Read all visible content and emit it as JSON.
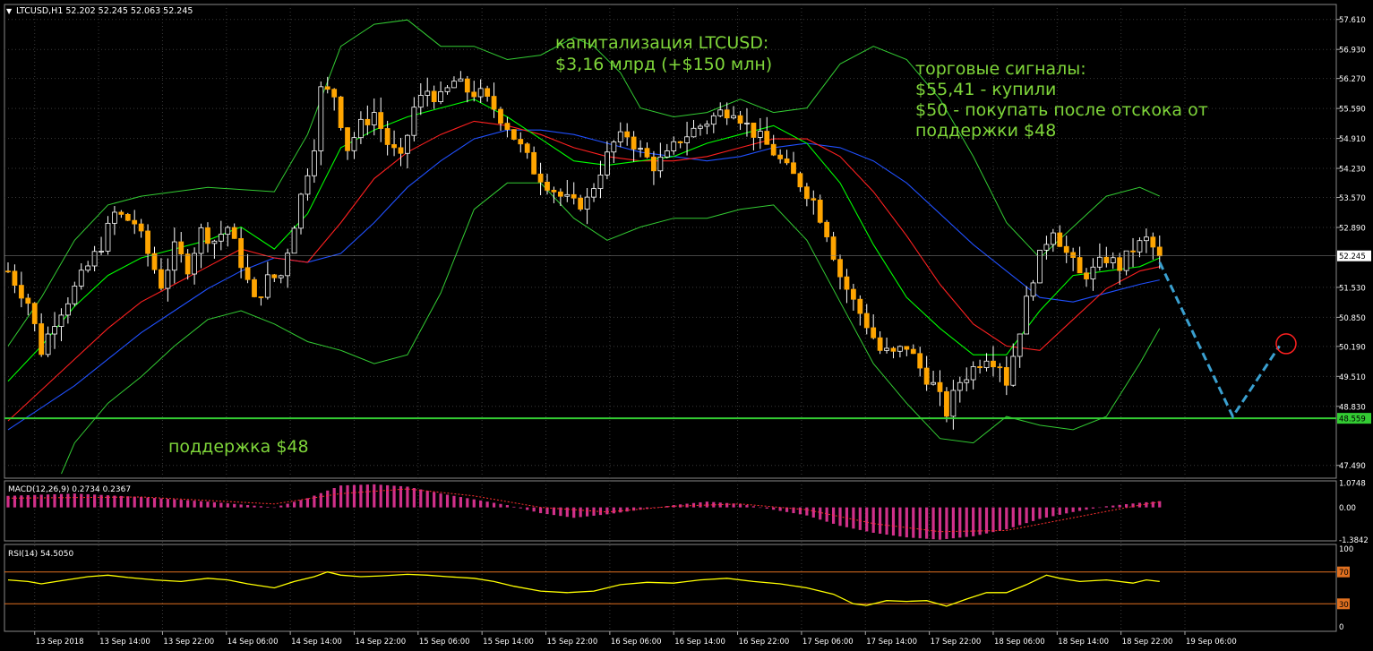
{
  "header": {
    "symbol_info": "LTCUSD,H1  52.202 52.245 52.063 52.245",
    "menu_arrow_icon": "triangle-down-icon"
  },
  "annotations": {
    "cap_line1": "капитализация LTCUSD:",
    "cap_line2": "$3,16 млрд (+$150 млн)",
    "signals_line1": "торговые сигналы:",
    "signals_line2": "$55,41 - купили",
    "signals_line3": "$50 - покупать после отскока от",
    "signals_line4": "поддержки $48",
    "support_label": "поддержка $48"
  },
  "colors": {
    "background": "#000000",
    "grid": "#3a3a3a",
    "bull_candle": "#000000",
    "bear_candle": "#ffa500",
    "bollinger": "#33cc33",
    "ma_fast": "#00ff00",
    "ma_mid": "#ff2020",
    "ma_slow": "#2050ff",
    "support": "#33cc33",
    "annotation_text": "#7fd63a",
    "forecast": "#3aa0d0",
    "target_circle": "#ff2020",
    "macd_hist": "#d0308a",
    "macd_signal": "#ff3030",
    "rsi_line": "#ffff00",
    "rsi_levels": "#e07020",
    "axis_text": "#ffffff"
  },
  "chart_data": {
    "type": "candlestick",
    "symbol": "LTCUSD",
    "timeframe": "H1",
    "ohlc_header": {
      "open": 52.202,
      "high": 52.245,
      "low": 52.063,
      "close": 52.245
    },
    "price_axis_ticks": [
      "57.610",
      "56.930",
      "56.270",
      "55.590",
      "54.910",
      "54.230",
      "53.570",
      "52.890",
      "52.245",
      "51.530",
      "50.850",
      "50.190",
      "49.510",
      "48.830",
      "48.559",
      "47.490"
    ],
    "ylim": [
      47.2,
      57.95
    ],
    "current_price": 52.245,
    "current_price_label": "52.245",
    "support_level": 48.559,
    "support_price_label": "48.559",
    "time_labels": [
      "13 Sep 2018",
      "13 Sep 14:00",
      "13 Sep 22:00",
      "14 Sep 06:00",
      "14 Sep 14:00",
      "14 Sep 22:00",
      "15 Sep 06:00",
      "15 Sep 14:00",
      "15 Sep 22:00",
      "16 Sep 06:00",
      "16 Sep 14:00",
      "16 Sep 22:00",
      "17 Sep 06:00",
      "17 Sep 14:00",
      "17 Sep 22:00",
      "18 Sep 06:00",
      "18 Sep 14:00",
      "18 Sep 22:00",
      "19 Sep 06:00"
    ],
    "close_path": [
      [
        0,
        51.9
      ],
      [
        3,
        51.2
      ],
      [
        5,
        50.1
      ],
      [
        7,
        50.8
      ],
      [
        10,
        51.5
      ],
      [
        14,
        52.5
      ],
      [
        16,
        53.2
      ],
      [
        19,
        53.0
      ],
      [
        21,
        52.3
      ],
      [
        23,
        51.6
      ],
      [
        25,
        52.4
      ],
      [
        27,
        52.0
      ],
      [
        29,
        52.8
      ],
      [
        31,
        52.6
      ],
      [
        33,
        52.9
      ],
      [
        35,
        52.1
      ],
      [
        37,
        51.2
      ],
      [
        39,
        51.7
      ],
      [
        41,
        51.8
      ],
      [
        42,
        52.4
      ],
      [
        44,
        53.6
      ],
      [
        46,
        54.8
      ],
      [
        47,
        56.0
      ],
      [
        49,
        55.9
      ],
      [
        51,
        54.7
      ],
      [
        53,
        55.2
      ],
      [
        55,
        55.5
      ],
      [
        57,
        54.8
      ],
      [
        59,
        54.4
      ],
      [
        61,
        55.6
      ],
      [
        63,
        56.0
      ],
      [
        65,
        55.8
      ],
      [
        67,
        56.2
      ],
      [
        69,
        56.0
      ],
      [
        71,
        55.9
      ],
      [
        73,
        55.6
      ],
      [
        75,
        55.2
      ],
      [
        77,
        54.7
      ],
      [
        79,
        54.2
      ],
      [
        81,
        53.9
      ],
      [
        83,
        53.6
      ],
      [
        85,
        53.4
      ],
      [
        87,
        53.5
      ],
      [
        89,
        54.2
      ],
      [
        91,
        54.8
      ],
      [
        93,
        55.0
      ],
      [
        95,
        54.6
      ],
      [
        97,
        54.3
      ],
      [
        99,
        54.5
      ],
      [
        101,
        54.9
      ],
      [
        103,
        55.1
      ],
      [
        105,
        55.3
      ],
      [
        107,
        55.5
      ],
      [
        109,
        55.6
      ],
      [
        111,
        55.2
      ],
      [
        113,
        54.9
      ],
      [
        115,
        54.6
      ],
      [
        117,
        54.2
      ],
      [
        119,
        53.9
      ],
      [
        121,
        53.5
      ],
      [
        123,
        52.8
      ],
      [
        125,
        51.8
      ],
      [
        127,
        51.2
      ],
      [
        129,
        50.7
      ],
      [
        131,
        50.1
      ],
      [
        133,
        50.0
      ],
      [
        135,
        50.2
      ],
      [
        137,
        49.7
      ],
      [
        139,
        49.3
      ],
      [
        141,
        48.7
      ],
      [
        143,
        49.4
      ],
      [
        145,
        49.7
      ],
      [
        147,
        50.0
      ],
      [
        149,
        49.8
      ],
      [
        150,
        49.4
      ],
      [
        152,
        50.6
      ],
      [
        154,
        51.8
      ],
      [
        156,
        52.6
      ],
      [
        157,
        52.9
      ],
      [
        159,
        52.3
      ],
      [
        161,
        51.8
      ],
      [
        163,
        51.9
      ],
      [
        165,
        52.2
      ],
      [
        167,
        52.0
      ],
      [
        169,
        52.4
      ],
      [
        171,
        52.6
      ],
      [
        173,
        52.245
      ]
    ],
    "bb_upper": [
      [
        0,
        50.2
      ],
      [
        5,
        51.3
      ],
      [
        10,
        52.6
      ],
      [
        15,
        53.4
      ],
      [
        20,
        53.6
      ],
      [
        30,
        53.8
      ],
      [
        40,
        53.7
      ],
      [
        45,
        55.0
      ],
      [
        50,
        57.0
      ],
      [
        55,
        57.5
      ],
      [
        60,
        57.6
      ],
      [
        65,
        57.0
      ],
      [
        70,
        57.0
      ],
      [
        75,
        56.7
      ],
      [
        80,
        56.8
      ],
      [
        85,
        57.2
      ],
      [
        88,
        57.0
      ],
      [
        92,
        56.4
      ],
      [
        95,
        55.6
      ],
      [
        100,
        55.4
      ],
      [
        105,
        55.5
      ],
      [
        110,
        55.8
      ],
      [
        115,
        55.5
      ],
      [
        120,
        55.6
      ],
      [
        125,
        56.6
      ],
      [
        130,
        57.0
      ],
      [
        135,
        56.7
      ],
      [
        140,
        55.8
      ],
      [
        145,
        54.5
      ],
      [
        150,
        53.0
      ],
      [
        155,
        52.2
      ],
      [
        160,
        52.9
      ],
      [
        165,
        53.6
      ],
      [
        170,
        53.8
      ],
      [
        173,
        53.6
      ]
    ],
    "bb_lower": [
      [
        8,
        47.3
      ],
      [
        10,
        48.0
      ],
      [
        15,
        48.9
      ],
      [
        20,
        49.5
      ],
      [
        25,
        50.2
      ],
      [
        30,
        50.8
      ],
      [
        35,
        51.0
      ],
      [
        40,
        50.7
      ],
      [
        45,
        50.3
      ],
      [
        50,
        50.1
      ],
      [
        55,
        49.8
      ],
      [
        60,
        50.0
      ],
      [
        65,
        51.4
      ],
      [
        70,
        53.3
      ],
      [
        75,
        53.9
      ],
      [
        80,
        53.9
      ],
      [
        85,
        53.1
      ],
      [
        90,
        52.6
      ],
      [
        95,
        52.9
      ],
      [
        100,
        53.1
      ],
      [
        105,
        53.1
      ],
      [
        110,
        53.3
      ],
      [
        115,
        53.4
      ],
      [
        120,
        52.6
      ],
      [
        125,
        51.2
      ],
      [
        130,
        49.8
      ],
      [
        135,
        48.9
      ],
      [
        140,
        48.1
      ],
      [
        145,
        48.0
      ],
      [
        150,
        48.6
      ],
      [
        155,
        48.4
      ],
      [
        160,
        48.3
      ],
      [
        165,
        48.6
      ],
      [
        170,
        49.8
      ],
      [
        173,
        50.6
      ]
    ],
    "ma_fast": [
      [
        0,
        49.4
      ],
      [
        5,
        50.2
      ],
      [
        10,
        51.1
      ],
      [
        15,
        51.8
      ],
      [
        20,
        52.2
      ],
      [
        25,
        52.4
      ],
      [
        30,
        52.6
      ],
      [
        35,
        52.9
      ],
      [
        40,
        52.4
      ],
      [
        45,
        53.2
      ],
      [
        50,
        54.7
      ],
      [
        55,
        55.1
      ],
      [
        60,
        55.4
      ],
      [
        65,
        55.6
      ],
      [
        70,
        55.8
      ],
      [
        75,
        55.4
      ],
      [
        80,
        54.9
      ],
      [
        85,
        54.4
      ],
      [
        90,
        54.3
      ],
      [
        95,
        54.4
      ],
      [
        100,
        54.5
      ],
      [
        105,
        54.8
      ],
      [
        110,
        55.0
      ],
      [
        115,
        55.2
      ],
      [
        120,
        54.8
      ],
      [
        125,
        53.9
      ],
      [
        130,
        52.5
      ],
      [
        135,
        51.3
      ],
      [
        140,
        50.6
      ],
      [
        145,
        50.0
      ],
      [
        150,
        50.0
      ],
      [
        155,
        51.0
      ],
      [
        160,
        51.8
      ],
      [
        165,
        51.9
      ],
      [
        170,
        52.0
      ],
      [
        173,
        52.2
      ]
    ],
    "ma_mid": [
      [
        0,
        48.5
      ],
      [
        5,
        49.2
      ],
      [
        10,
        49.9
      ],
      [
        15,
        50.6
      ],
      [
        20,
        51.2
      ],
      [
        25,
        51.6
      ],
      [
        30,
        52.0
      ],
      [
        35,
        52.4
      ],
      [
        40,
        52.2
      ],
      [
        45,
        52.1
      ],
      [
        50,
        53.0
      ],
      [
        55,
        54.0
      ],
      [
        60,
        54.6
      ],
      [
        65,
        55.0
      ],
      [
        70,
        55.3
      ],
      [
        75,
        55.2
      ],
      [
        80,
        55.0
      ],
      [
        85,
        54.7
      ],
      [
        90,
        54.5
      ],
      [
        95,
        54.4
      ],
      [
        100,
        54.4
      ],
      [
        105,
        54.5
      ],
      [
        110,
        54.7
      ],
      [
        115,
        54.9
      ],
      [
        120,
        54.9
      ],
      [
        125,
        54.5
      ],
      [
        130,
        53.7
      ],
      [
        135,
        52.7
      ],
      [
        140,
        51.6
      ],
      [
        145,
        50.7
      ],
      [
        150,
        50.2
      ],
      [
        155,
        50.1
      ],
      [
        160,
        50.8
      ],
      [
        165,
        51.5
      ],
      [
        170,
        51.9
      ],
      [
        173,
        52.0
      ]
    ],
    "ma_slow": [
      [
        0,
        48.3
      ],
      [
        5,
        48.8
      ],
      [
        10,
        49.3
      ],
      [
        15,
        49.9
      ],
      [
        20,
        50.5
      ],
      [
        25,
        51.0
      ],
      [
        30,
        51.5
      ],
      [
        35,
        51.9
      ],
      [
        40,
        52.2
      ],
      [
        45,
        52.1
      ],
      [
        50,
        52.3
      ],
      [
        55,
        53.0
      ],
      [
        60,
        53.8
      ],
      [
        65,
        54.4
      ],
      [
        70,
        54.9
      ],
      [
        75,
        55.1
      ],
      [
        80,
        55.1
      ],
      [
        85,
        55.0
      ],
      [
        90,
        54.8
      ],
      [
        95,
        54.6
      ],
      [
        100,
        54.5
      ],
      [
        105,
        54.4
      ],
      [
        110,
        54.5
      ],
      [
        115,
        54.7
      ],
      [
        120,
        54.8
      ],
      [
        125,
        54.7
      ],
      [
        130,
        54.4
      ],
      [
        135,
        53.9
      ],
      [
        140,
        53.2
      ],
      [
        145,
        52.5
      ],
      [
        150,
        51.9
      ],
      [
        155,
        51.3
      ],
      [
        160,
        51.2
      ],
      [
        165,
        51.4
      ],
      [
        170,
        51.6
      ],
      [
        173,
        51.7
      ]
    ],
    "forecast_path": [
      [
        173,
        52.1
      ],
      [
        184,
        48.6
      ],
      [
        191,
        50.2
      ]
    ],
    "target_point": [
      192,
      50.25
    ],
    "macd": {
      "label": "MACD(12,26,9) 0.2734 0.2367",
      "ticks": [
        "1.0748",
        "0.00",
        "-1.3842"
      ],
      "ylim": [
        -1.45,
        1.15
      ],
      "histogram_path": [
        [
          0,
          0.5
        ],
        [
          10,
          0.6
        ],
        [
          20,
          0.45
        ],
        [
          30,
          0.25
        ],
        [
          40,
          0.0
        ],
        [
          45,
          0.4
        ],
        [
          50,
          0.95
        ],
        [
          55,
          1.0
        ],
        [
          60,
          0.9
        ],
        [
          65,
          0.6
        ],
        [
          70,
          0.35
        ],
        [
          75,
          0.1
        ],
        [
          80,
          -0.25
        ],
        [
          85,
          -0.45
        ],
        [
          90,
          -0.3
        ],
        [
          95,
          -0.1
        ],
        [
          100,
          0.1
        ],
        [
          105,
          0.25
        ],
        [
          110,
          0.15
        ],
        [
          115,
          -0.1
        ],
        [
          120,
          -0.35
        ],
        [
          125,
          -0.8
        ],
        [
          130,
          -1.1
        ],
        [
          135,
          -1.3
        ],
        [
          140,
          -1.4
        ],
        [
          145,
          -1.25
        ],
        [
          150,
          -0.95
        ],
        [
          155,
          -0.5
        ],
        [
          160,
          -0.2
        ],
        [
          165,
          0.05
        ],
        [
          170,
          0.2
        ],
        [
          173,
          0.27
        ]
      ],
      "signal_path": [
        [
          0,
          0.4
        ],
        [
          20,
          0.45
        ],
        [
          40,
          0.15
        ],
        [
          50,
          0.6
        ],
        [
          60,
          0.8
        ],
        [
          70,
          0.5
        ],
        [
          80,
          0.0
        ],
        [
          90,
          -0.2
        ],
        [
          100,
          0.05
        ],
        [
          110,
          0.15
        ],
        [
          120,
          -0.1
        ],
        [
          130,
          -0.7
        ],
        [
          140,
          -1.05
        ],
        [
          150,
          -1.0
        ],
        [
          160,
          -0.45
        ],
        [
          170,
          0.1
        ],
        [
          173,
          0.24
        ]
      ]
    },
    "rsi": {
      "label": "RSI(14) 54.5050",
      "ticks": [
        "100",
        "70",
        "30",
        "0"
      ],
      "levels": [
        70,
        30
      ],
      "path": [
        [
          0,
          60
        ],
        [
          3,
          58
        ],
        [
          5,
          55
        ],
        [
          8,
          59
        ],
        [
          12,
          64
        ],
        [
          15,
          66
        ],
        [
          18,
          63
        ],
        [
          22,
          60
        ],
        [
          26,
          58
        ],
        [
          30,
          62
        ],
        [
          33,
          60
        ],
        [
          36,
          55
        ],
        [
          40,
          50
        ],
        [
          43,
          58
        ],
        [
          46,
          64
        ],
        [
          48,
          70
        ],
        [
          50,
          66
        ],
        [
          53,
          64
        ],
        [
          56,
          65
        ],
        [
          60,
          67
        ],
        [
          63,
          66
        ],
        [
          66,
          64
        ],
        [
          70,
          62
        ],
        [
          73,
          58
        ],
        [
          76,
          52
        ],
        [
          80,
          46
        ],
        [
          84,
          44
        ],
        [
          88,
          46
        ],
        [
          92,
          54
        ],
        [
          96,
          57
        ],
        [
          100,
          56
        ],
        [
          104,
          60
        ],
        [
          108,
          62
        ],
        [
          112,
          58
        ],
        [
          116,
          55
        ],
        [
          120,
          50
        ],
        [
          124,
          42
        ],
        [
          127,
          30
        ],
        [
          129,
          28
        ],
        [
          132,
          34
        ],
        [
          135,
          33
        ],
        [
          138,
          34
        ],
        [
          141,
          27
        ],
        [
          144,
          36
        ],
        [
          147,
          44
        ],
        [
          150,
          44
        ],
        [
          153,
          54
        ],
        [
          156,
          66
        ],
        [
          158,
          62
        ],
        [
          161,
          58
        ],
        [
          165,
          60
        ],
        [
          169,
          56
        ],
        [
          171,
          60
        ],
        [
          173,
          58
        ]
      ]
    }
  }
}
